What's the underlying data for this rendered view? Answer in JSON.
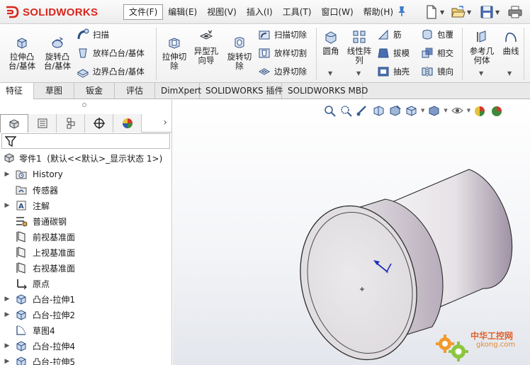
{
  "app": {
    "brand": "SOLIDWORKS"
  },
  "menu": {
    "items": [
      "文件(F)",
      "编辑(E)",
      "视图(V)",
      "插入(I)",
      "工具(T)",
      "窗口(W)",
      "帮助(H)"
    ],
    "active_index": 0
  },
  "ribbon": {
    "extrude_boss": "拉伸凸\n台/基体",
    "revolve_boss": "旋转凸\n台/基体",
    "sweep": "扫描",
    "loft_boss": "放样凸台/基体",
    "boundary_boss": "边界凸台/基体",
    "extrude_cut": "拉伸切\n除",
    "hole_wizard": "异型孔\n向导",
    "revolve_cut": "旋转切\n除",
    "swept_cut": "扫描切除",
    "lofted_cut": "放样切割",
    "boundary_cut": "边界切除",
    "fillet": "圆角",
    "linear_pattern": "线性阵\n列",
    "rib": "筋",
    "draft": "拔模",
    "shell": "抽壳",
    "wrap": "包覆",
    "intersect": "相交",
    "mirror": "镜向",
    "ref_geometry": "参考几\n何体",
    "curves": "曲线"
  },
  "tabs": [
    "特征",
    "草图",
    "钣金",
    "评估",
    "DimXpert",
    "SOLIDWORKS 插件",
    "SOLIDWORKS MBD"
  ],
  "tree": {
    "root": "零件1  (默认<<默认>_显示状态 1>)",
    "nodes": [
      {
        "label": "History",
        "icon": "history-folder-icon",
        "expandable": true
      },
      {
        "label": "传感器",
        "icon": "sensor-icon",
        "expandable": false
      },
      {
        "label": "注解",
        "icon": "annotations-icon",
        "expandable": true
      },
      {
        "label": "普通碳钢",
        "icon": "material-icon",
        "expandable": false
      },
      {
        "label": "前视基准面",
        "icon": "plane-icon",
        "expandable": false
      },
      {
        "label": "上视基准面",
        "icon": "plane-icon",
        "expandable": false
      },
      {
        "label": "右视基准面",
        "icon": "plane-icon",
        "expandable": false
      },
      {
        "label": "原点",
        "icon": "origin-icon",
        "expandable": false
      },
      {
        "label": "凸台-拉伸1",
        "icon": "extrude-feature-icon",
        "expandable": true
      },
      {
        "label": "凸台-拉伸2",
        "icon": "extrude-feature-icon",
        "expandable": true
      },
      {
        "label": "草图4",
        "icon": "sketch-icon",
        "expandable": false
      },
      {
        "label": "凸台-拉伸4",
        "icon": "extrude-feature-icon",
        "expandable": true
      },
      {
        "label": "凸台-拉伸5",
        "icon": "extrude-feature-icon",
        "expandable": true
      }
    ]
  },
  "watermark": {
    "name": "中华工控网",
    "url": "gkong.com"
  },
  "colors": {
    "brand_red": "#d9251d",
    "part_face": "#e6e3e6",
    "part_shade": "#b3a9b6",
    "edge": "#2b2b2b"
  }
}
